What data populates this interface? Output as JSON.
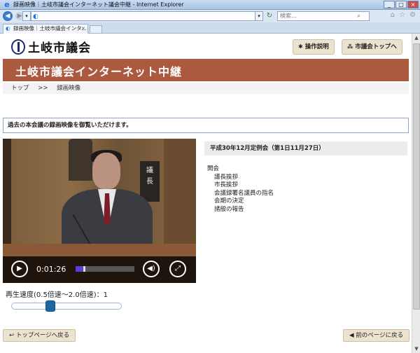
{
  "browser": {
    "window_title": "録画映像｜土岐市議会インターネット議会中継 - Internet Explorer",
    "search_placeholder": "検索...",
    "tab_title": "録画映像｜土岐市議会インタ...",
    "window_buttons": [
      "_",
      "□",
      "×"
    ]
  },
  "site": {
    "logo_text": "土岐市議会",
    "buttons": {
      "help": "操作説明",
      "council_top": "市議会トップへ"
    },
    "banner_title": "土岐市議会インターネット中継",
    "breadcrumb": [
      "トップ",
      ">>",
      "録画映像"
    ]
  },
  "main": {
    "notice": "過去の本会議の録画映像を御覧いただけます。",
    "video": {
      "sign_text": "議\n長",
      "time": "0:01:26",
      "progress_fraction": 0.13,
      "buffered_fraction": 0.17
    },
    "speed": {
      "label": "再生速度(0.5倍速〜2.0倍速)：1",
      "value": 1,
      "min": 0.5,
      "max": 2.0
    },
    "session": {
      "title": "平成30年12月定例会（第1日11月27日）",
      "agenda_head": "開会",
      "agenda_items": [
        "議長挨拶",
        "市長挨拶",
        "会議録署名議員の指名",
        "会期の決定",
        "諸般の報告"
      ]
    },
    "bottom_buttons": {
      "back_top": "トップページへ戻る",
      "prev_page": "前のページに戻る"
    }
  },
  "colors": {
    "banner": "#ac5a3f",
    "button_bg": "#ebe3cf",
    "progress": "#5a3fd6",
    "slider_knob": "#1d66a6"
  }
}
